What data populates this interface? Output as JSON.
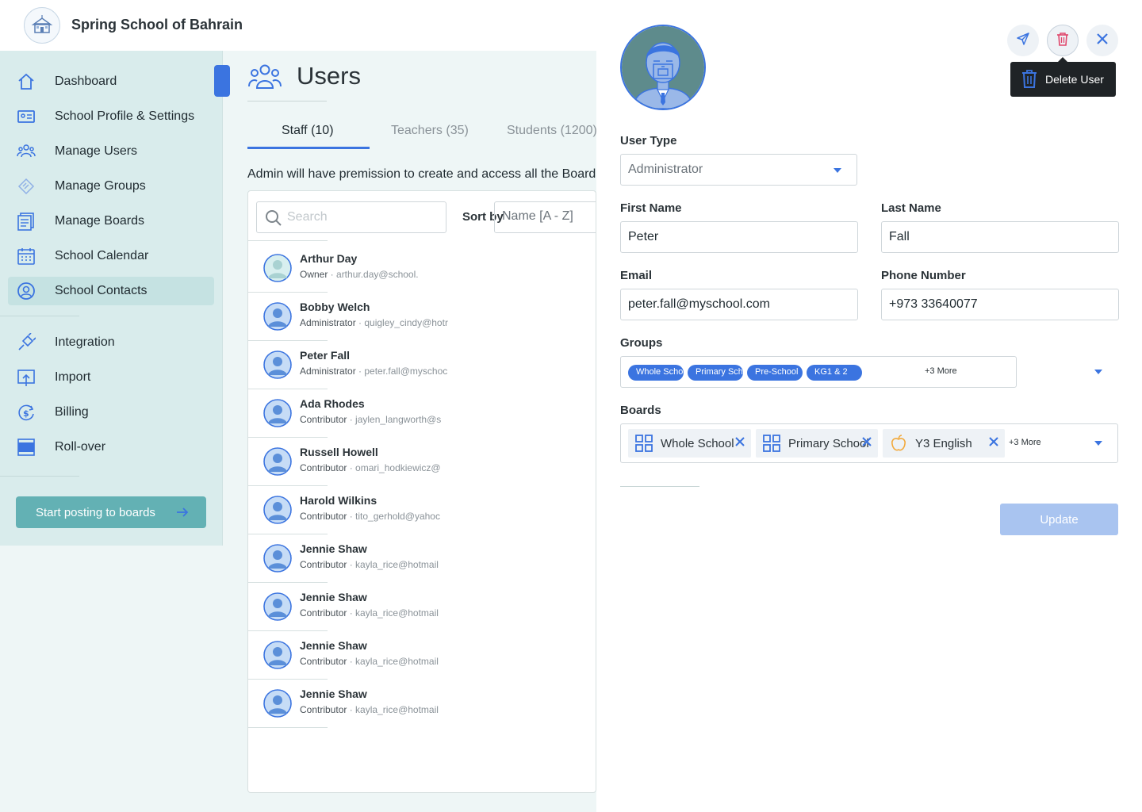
{
  "brand": {
    "name": "Spring School of Bahrain"
  },
  "sidebar": {
    "items": [
      {
        "label": "Dashboard",
        "icon": "home-icon"
      },
      {
        "label": "School Profile & Settings",
        "icon": "id-card-icon"
      },
      {
        "label": "Manage Users",
        "icon": "users-icon"
      },
      {
        "label": "Manage Groups",
        "icon": "layers-icon"
      },
      {
        "label": "Manage Boards",
        "icon": "boards-icon"
      },
      {
        "label": "School Calendar",
        "icon": "calendar-icon"
      },
      {
        "label": "School Contacts",
        "icon": "contact-icon",
        "active": true
      },
      {
        "label": "Integration",
        "icon": "plug-icon"
      },
      {
        "label": "Import",
        "icon": "import-icon"
      },
      {
        "label": "Billing",
        "icon": "billing-icon"
      },
      {
        "label": "Roll-over",
        "icon": "rollover-icon"
      }
    ],
    "cta_label": "Start posting to boards"
  },
  "main": {
    "title": "Users",
    "tabs": [
      {
        "label": "Staff (10)",
        "active": true
      },
      {
        "label": "Teachers (35)"
      },
      {
        "label": "Students (1200)"
      }
    ],
    "description": "Admin will have premission to create and access all the Boards",
    "search_placeholder": "Search",
    "sort_label": "Sort by",
    "sort_value": "Name [A - Z]",
    "users": [
      {
        "name": "Arthur Day",
        "role": "Owner",
        "email": "arthur.day@school."
      },
      {
        "name": "Bobby Welch",
        "role": "Administrator",
        "email": "quigley_cindy@hotr"
      },
      {
        "name": "Peter Fall",
        "role": "Administrator",
        "email": "peter.fall@myschoc"
      },
      {
        "name": "Ada Rhodes",
        "role": "Contributor",
        "email": "jaylen_langworth@s"
      },
      {
        "name": "Russell Howell",
        "role": "Contributor",
        "email": "omari_hodkiewicz@"
      },
      {
        "name": "Harold Wilkins",
        "role": "Contributor",
        "email": "tito_gerhold@yahoc"
      },
      {
        "name": "Jennie Shaw",
        "role": "Contributor",
        "email": "kayla_rice@hotmail"
      },
      {
        "name": "Jennie Shaw",
        "role": "Contributor",
        "email": "kayla_rice@hotmail"
      },
      {
        "name": "Jennie Shaw",
        "role": "Contributor",
        "email": "kayla_rice@hotmail"
      },
      {
        "name": "Jennie Shaw",
        "role": "Contributor",
        "email": "kayla_rice@hotmail"
      }
    ]
  },
  "panel": {
    "tooltip": "Delete User",
    "user_type_label": "User Type",
    "user_type_value": "Administrator",
    "first_name_label": "First Name",
    "first_name_value": "Peter",
    "last_name_label": "Last Name",
    "last_name_value": "Fall",
    "email_label": "Email",
    "email_value": "peter.fall@myschool.com",
    "phone_label": "Phone Number",
    "phone_value": "+973 33640077",
    "groups_label": "Groups",
    "groups": [
      "Whole School",
      "Primary School",
      "Pre-School",
      "KG1 & 2"
    ],
    "groups_more": "+3 More",
    "boards_label": "Boards",
    "boards": [
      {
        "label": "Whole School",
        "icon": "grid-icon"
      },
      {
        "label": "Primary School",
        "icon": "grid-icon"
      },
      {
        "label": "Y3 English",
        "icon": "apple-icon"
      }
    ],
    "boards_more": "+3 More",
    "update_label": "Update"
  },
  "colors": {
    "accent": "#3b74e0",
    "sidebar_bg": "#d9ecec",
    "cta": "#63b1b4",
    "delete": "#e0466b"
  }
}
